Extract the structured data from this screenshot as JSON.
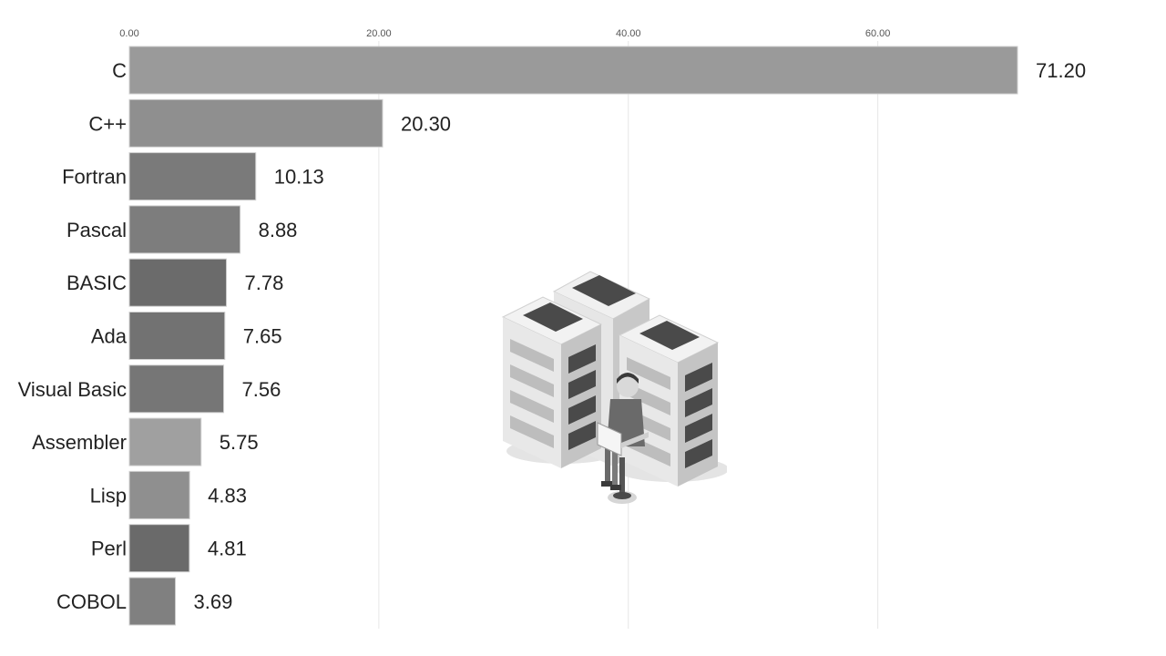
{
  "chart_data": {
    "type": "bar",
    "orientation": "horizontal",
    "title": "",
    "xlabel": "",
    "ylabel": "",
    "xlim": [
      0,
      71.2
    ],
    "x_ticks": [
      0,
      20,
      40,
      60
    ],
    "x_tick_labels": [
      "0.00",
      "20.00",
      "40.00",
      "60.00"
    ],
    "grid": "vertical",
    "value_label_format": "2 decimals",
    "categories": [
      "C",
      "C++",
      "Fortran",
      "Pascal",
      "BASIC",
      "Ada",
      "Visual Basic",
      "Assembler",
      "Lisp",
      "Perl",
      "COBOL"
    ],
    "values": [
      71.2,
      20.3,
      10.13,
      8.88,
      7.78,
      7.65,
      7.56,
      5.75,
      4.83,
      4.81,
      3.69
    ],
    "value_labels": [
      "71.20",
      "20.30",
      "10.13",
      "8.88",
      "7.78",
      "7.65",
      "7.56",
      "5.75",
      "4.83",
      "4.81",
      "3.69"
    ],
    "bar_colors": [
      "#9a9a9a",
      "#8f8f8f",
      "#7a7a7a",
      "#7d7d7d",
      "#6b6b6b",
      "#727272",
      "#767676",
      "#a0a0a0",
      "#8f8f8f",
      "#6a6a6a",
      "#808080"
    ]
  },
  "illustration": {
    "icon": "server-racks-with-person-icon",
    "colors": {
      "light": "#ececec",
      "mid": "#bdbdbd",
      "dark": "#4a4a4a",
      "shadow": "#e2e2e2"
    }
  }
}
